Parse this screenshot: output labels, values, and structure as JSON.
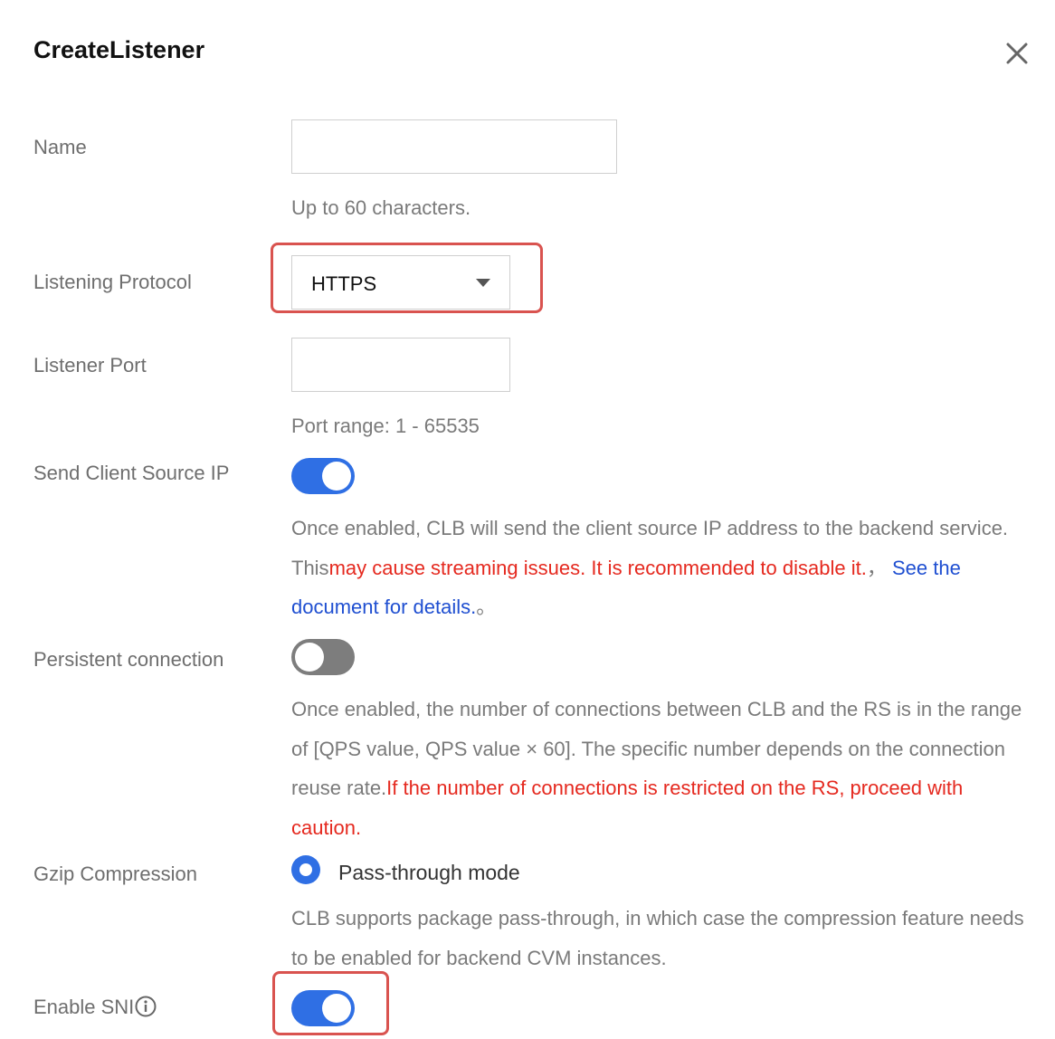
{
  "dialog": {
    "title": "CreateListener",
    "close_icon": "close-icon"
  },
  "name_field": {
    "label": "Name",
    "value": "",
    "placeholder": "",
    "hint": "Up to 60 characters."
  },
  "protocol": {
    "label": "Listening Protocol",
    "selected": "HTTPS",
    "highlight_color": "#d9534f"
  },
  "port_field": {
    "label": "Listener Port",
    "value": "",
    "hint": "Port range: 1 - 65535"
  },
  "client_ip": {
    "label": "Send Client Source IP",
    "enabled": true,
    "desc_plain": "Once enabled, CLB will send the client source IP address to the backend service. This",
    "desc_warning": "may cause streaming issues. It is recommended to disable it.",
    "sep": "，",
    "link": "See the document for details.",
    "end": "。"
  },
  "persistent": {
    "label": "Persistent connection",
    "enabled": false,
    "desc_plain": "Once enabled, the number of connections between CLB and the RS is in the range of [QPS value, QPS value × 60]. The specific number depends on the connection reuse rate.",
    "desc_warning": "If the number of connections is restricted on the RS, proceed with caution."
  },
  "gzip": {
    "label": "Gzip Compression",
    "option": "Pass-through mode",
    "selected": true,
    "desc": "CLB supports package pass-through, in which case the compression feature needs to be enabled for backend CVM instances."
  },
  "sni": {
    "label": "Enable SNI",
    "info_icon": "info-icon",
    "enabled": true
  },
  "colors": {
    "accent": "#2f6fe4",
    "warning": "#e5291f",
    "link": "#1f4fd1"
  }
}
